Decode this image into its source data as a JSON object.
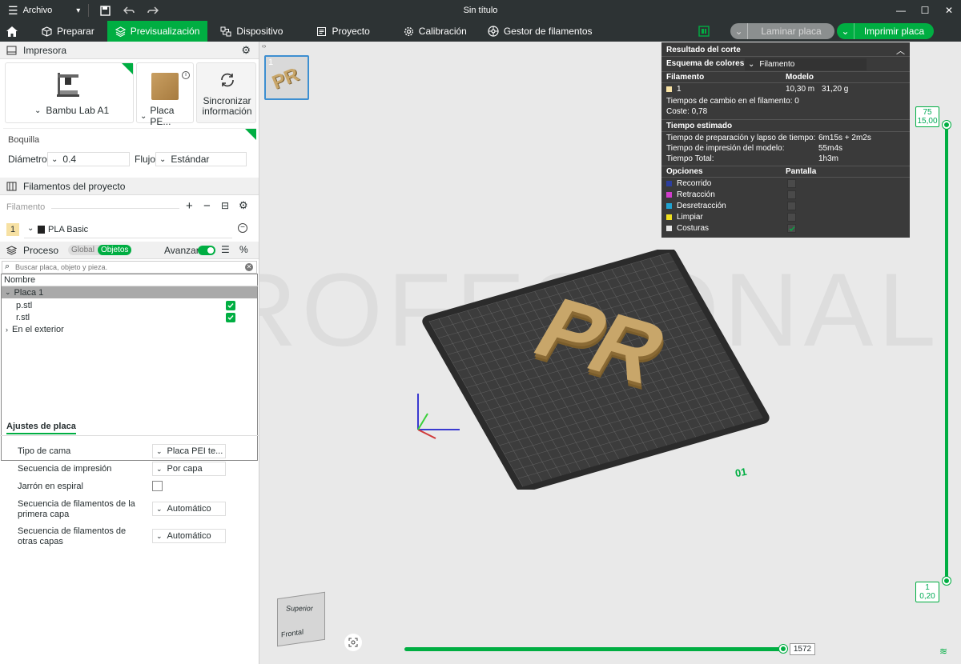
{
  "titlebar": {
    "menu_label": "Archivo",
    "title": "Sin título"
  },
  "tabs": [
    {
      "label": "Preparar"
    },
    {
      "label": "Previsualización"
    },
    {
      "label": "Dispositivo"
    },
    {
      "label": "Proyecto"
    },
    {
      "label": "Calibración"
    },
    {
      "label": "Gestor de filamentos"
    }
  ],
  "actions": {
    "slice": "Laminar placa",
    "print": "Imprimir placa"
  },
  "printer": {
    "header": "Impresora",
    "model": "Bambu Lab A1",
    "plate": "Placa PE...",
    "sync": "Sincronizar información",
    "nozzle_label": "Boquilla",
    "diameter_label": "Diámetro",
    "diameter": "0.4",
    "flow_label": "Flujo",
    "flow": "Estándar"
  },
  "filaments": {
    "header": "Filamentos del proyecto",
    "col_label": "Filamento",
    "items": [
      {
        "index": "1",
        "name": "PLA Basic"
      }
    ]
  },
  "process": {
    "header": "Proceso",
    "global": "Global",
    "objects": "Objetos",
    "advance": "Avanzar",
    "search_placeholder": "Buscar placa, objeto y pieza.",
    "tree_header": "Nombre",
    "plate": "Placa 1",
    "objects_list": [
      "p.stl",
      "r.stl"
    ],
    "outside": "En el exterior"
  },
  "plate_settings": {
    "header": "Ajustes de placa",
    "bed_label": "Tipo de cama",
    "bed_value": "Placa PEI te...",
    "seq_label": "Secuencia de impresión",
    "seq_value": "Por capa",
    "vase_label": "Jarrón en espiral",
    "first_layer_label_1": "Secuencia de filamentos de la",
    "first_layer_label_2": "primera capa",
    "first_layer_value": "Automático",
    "other_layers_label_1": "Secuencia de filamentos de",
    "other_layers_label_2": "otras capas",
    "other_layers_value": "Automático"
  },
  "thumb": {
    "number": "1"
  },
  "slice_result": {
    "title": "Resultado del corte",
    "scheme_label": "Esquema de colores",
    "scheme_value": "Filamento",
    "col_filament": "Filamento",
    "col_model": "Modelo",
    "filament_index": "1",
    "length": "10,30 m",
    "weight": "31,20 g",
    "changes": "Tiempos de cambio en el filamento: 0",
    "cost": "Coste: 0,78",
    "time_header": "Tiempo estimado",
    "prep_label": "Tiempo de preparación y lapso de tiempo:",
    "prep_value": "6m15s + 2m2s",
    "model_label": "Tiempo de impresión del modelo:",
    "model_value": "55m4s",
    "total_label": "Tiempo Total:",
    "total_value": "1h3m",
    "options_header": "Opciones",
    "display_header": "Pantalla",
    "options": [
      {
        "name": "Recorrido",
        "color": "#2c3e9e",
        "checked": false
      },
      {
        "name": "Retracción",
        "color": "#d13ccb",
        "checked": false
      },
      {
        "name": "Desretracción",
        "color": "#1fa3d1",
        "checked": false
      },
      {
        "name": "Limpiar",
        "color": "#f0e020",
        "checked": false
      },
      {
        "name": "Costuras",
        "color": "#e6e6e6",
        "checked": true
      }
    ]
  },
  "layer_slider": {
    "top_layer": "75",
    "top_height": "15,00",
    "bottom_layer": "1",
    "bottom_height": "0,20"
  },
  "move_slider": {
    "value": "1572"
  },
  "cube": {
    "top": "Superior",
    "front": "Frontal"
  },
  "plate_label": "01",
  "watermark": "PROFESIONAL",
  "colors": {
    "accent": "#00ae42",
    "dark": "#2d3334",
    "filament": "#c8a66a"
  }
}
